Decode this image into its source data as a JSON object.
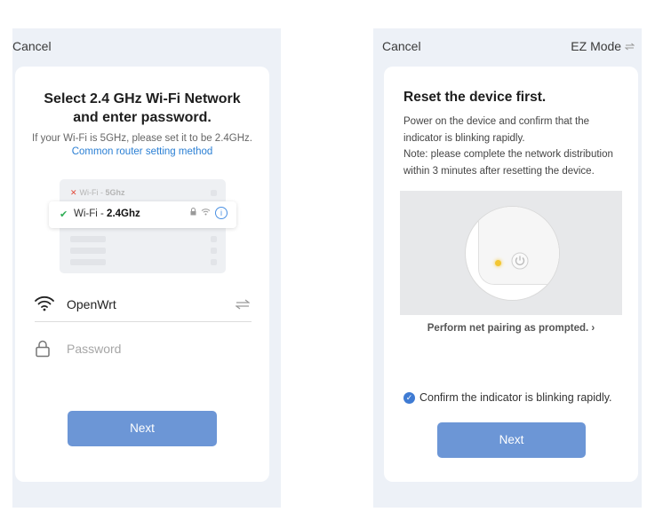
{
  "left": {
    "cancel": "Cancel",
    "title_line1": "Select 2.4 GHz Wi-Fi Network",
    "title_line2": "and enter password.",
    "subtitle": "If your Wi-Fi is 5GHz, please set it to be 2.4GHz. ",
    "subtitle_link": "Common router setting method",
    "illustration": {
      "row_5ghz_prefix": "Wi-Fi - ",
      "row_5ghz_band": "5Ghz",
      "row_24_prefix": "Wi-Fi - ",
      "row_24_band": "2.4Ghz"
    },
    "ssid_value": "OpenWrt",
    "password_placeholder": "Password",
    "next": "Next"
  },
  "right": {
    "cancel": "Cancel",
    "ez_mode": "EZ Mode",
    "title": "Reset the device first.",
    "body_line1": "Power on the device and confirm that the",
    "body_line2": "indicator is blinking rapidly.",
    "body_line3": "Note: please complete the network distribution",
    "body_line4": "within 3 minutes after resetting the device.",
    "prompt_link": "Perform net pairing as prompted. ›",
    "confirm_label": "Confirm the indicator is blinking rapidly.",
    "confirm_checked": true,
    "next": "Next"
  },
  "colors": {
    "background": "#edf1f7",
    "button": "#6c96d6",
    "link": "#2a7fd4",
    "led": "#f3c632",
    "check": "#2fae55"
  }
}
